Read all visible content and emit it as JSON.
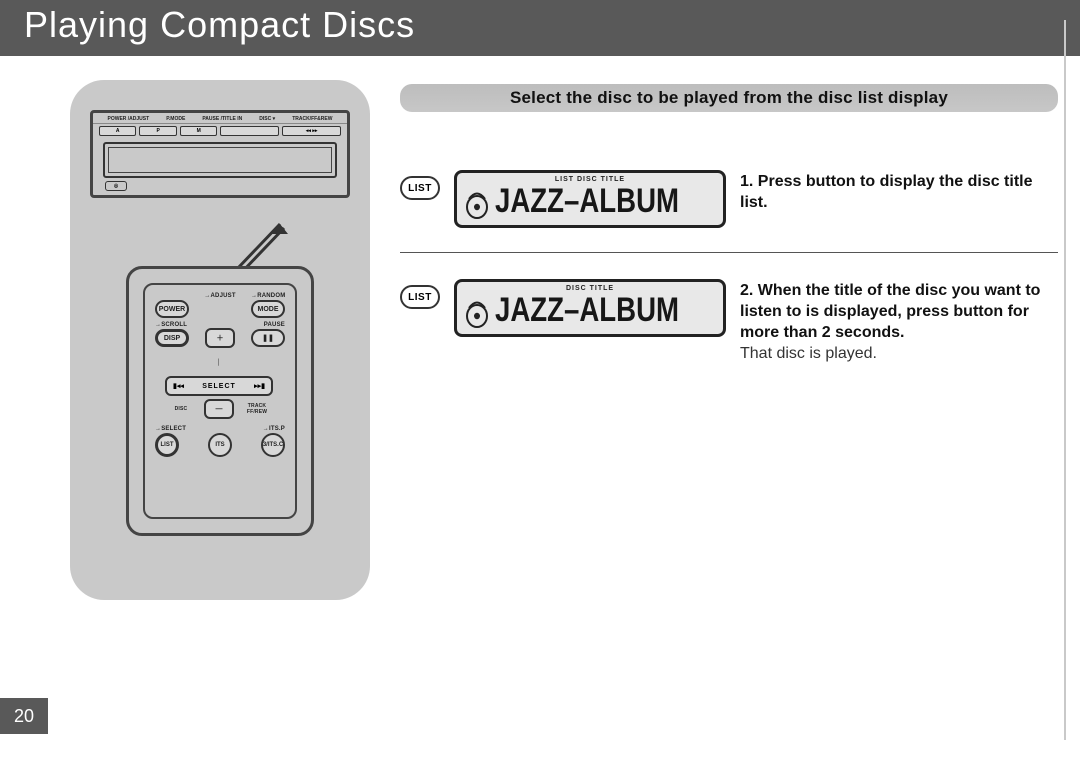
{
  "header": {
    "title": "Playing Compact Discs"
  },
  "section": {
    "heading": "Select the disc to be played from the disc list display"
  },
  "list_button_label": "LIST",
  "lcd1": {
    "tags": "LIST  DISC TITLE",
    "text": "JAZZ–ALBUM"
  },
  "lcd2": {
    "tags": "DISC TITLE",
    "text": "JAZZ–ALBUM"
  },
  "steps": {
    "s1": {
      "bold": "1. Press button to display the disc title list."
    },
    "s2": {
      "bold": "2. When the title of the disc you want to listen to is displayed, press button for more than 2 seconds.",
      "plain": "That disc is played."
    }
  },
  "headunit": {
    "labels": [
      "POWER /ADJUST",
      "P.MODE",
      "PAUSE /TITLE IN",
      "DISC ▾",
      "TRACK/FF&REW"
    ],
    "btns": [
      "A",
      "P",
      "M",
      "",
      "◂◂  ▸▸"
    ],
    "cd": "◎"
  },
  "remote": {
    "top_labels": {
      "left": "",
      "mid_small": "→ADJUST",
      "right_small": "→RANDOM"
    },
    "row1": {
      "l": "POWER",
      "r": "MODE"
    },
    "row2_labels": {
      "l": "→SCROLL",
      "r": "PAUSE"
    },
    "row2": {
      "l": "DISP",
      "m": "＋",
      "r": "❚❚"
    },
    "select_label": "SELECT",
    "select_left": "▮◂◂",
    "select_right": "▸▸▮",
    "below_labels": {
      "l": "DISC",
      "m": "—",
      "r": "TRACK FF/REW"
    },
    "row4_labels": {
      "l": "→SELECT",
      "r": "→ITS.P"
    },
    "row4": {
      "l": "LIST",
      "m": "ITS",
      "r": "3/ITS.C"
    }
  },
  "page_number": "20"
}
